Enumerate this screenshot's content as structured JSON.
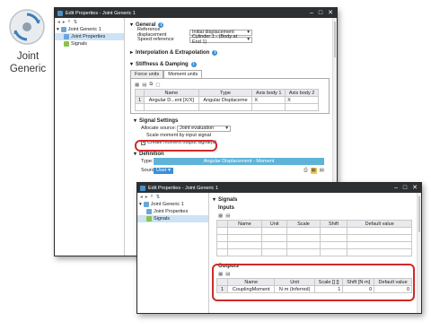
{
  "icon": {
    "title_line1": "Joint",
    "title_line2": "Generic"
  },
  "win1": {
    "title": "Edit Properties - Joint Generic 1",
    "controls": [
      "–",
      "□",
      "✕"
    ],
    "tree": [
      {
        "label": "Joint Generic 1"
      },
      {
        "label": "Joint Properties"
      },
      {
        "label": "Signals"
      }
    ],
    "general": {
      "heading": "General",
      "rows": [
        {
          "label": "Reference displacement",
          "value": "Initial displacement"
        },
        {
          "label": "Speed reference",
          "value": "Cylinder 1 - (Body at End 1)"
        }
      ]
    },
    "interp_heading": "Interpolation & Extrapolation",
    "stiffness_heading": "Stiffness & Damping",
    "tabs": [
      "Force units",
      "Moment units"
    ],
    "table": {
      "headers": [
        "",
        "Name",
        "Type",
        "Axis body 1",
        "Axis body 2"
      ],
      "rows": [
        [
          "1",
          "Angular D...ent [X/X]",
          "Angular Displaceme",
          "X",
          "X"
        ]
      ]
    },
    "signal_settings": {
      "heading": "Signal Settings",
      "allocate_label": "Allocate source:",
      "allocate_value": "Joint evaluation",
      "scale_label": "Scale moment by input signal",
      "create_label": "Create moment output signal(s)"
    },
    "definition": {
      "heading": "Definition",
      "type_label": "Type:",
      "type_value": "Angular Displacement - Moment",
      "source_label": "Source:",
      "source_value": "User"
    }
  },
  "win2": {
    "title": "Edit Properties - Joint Generic 1",
    "tree": [
      {
        "label": "Joint Generic 1"
      },
      {
        "label": "Joint Properties"
      },
      {
        "label": "Signals"
      }
    ],
    "signals_heading": "Signals",
    "inputs_heading": "Inputs",
    "inputs_headers": [
      "",
      "Name",
      "Unit",
      "Scale",
      "Shift",
      "Default value"
    ],
    "outputs_heading": "Outputs",
    "outputs_headers": [
      "",
      "Name",
      "Unit",
      "Scale [] []",
      "Shift [N·m]",
      "Default value"
    ],
    "outputs_rows": [
      [
        "1",
        "CouplingMoment",
        "N·m (Inferred)",
        "1",
        "0",
        "0"
      ]
    ]
  }
}
